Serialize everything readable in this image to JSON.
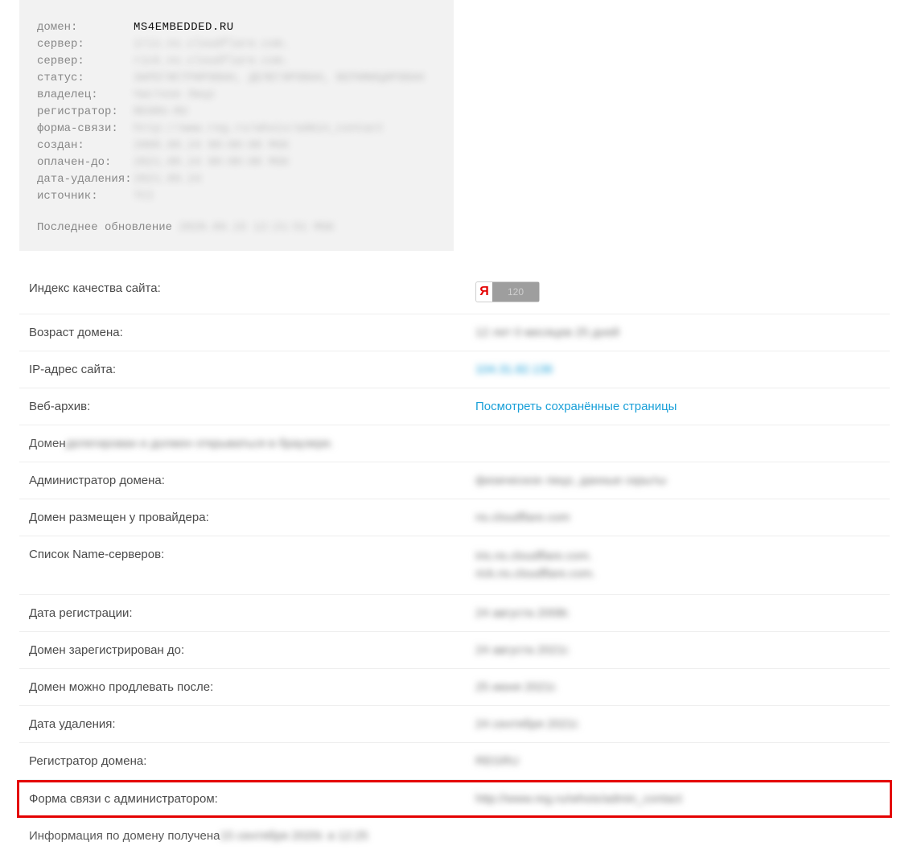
{
  "whois": {
    "fields": [
      {
        "label": "домен:",
        "value": "MS4EMBEDDED.RU",
        "sharp": true
      },
      {
        "label": "сервер:",
        "value": "iris.ns.cloudflare.com.",
        "sharp": false
      },
      {
        "label": "сервер:",
        "value": "rick.ns.cloudflare.com.",
        "sharp": false
      },
      {
        "label": "статус:",
        "value": "ЗАРЕГИСТРИРОВАН, ДЕЛЕГИРОВАН, ВЕРИФИЦИРОВАН",
        "sharp": false
      },
      {
        "label": "владелец:",
        "value": "Частное Лицо",
        "sharp": false
      },
      {
        "label": "регистратор:",
        "value": "REGRU-RU",
        "sharp": false
      },
      {
        "label": "форма-связи:",
        "value": "http://www.reg.ru/whois/admin_contact",
        "sharp": false
      },
      {
        "label": "создан:",
        "value": "2008.08.24 00:00:00 MSK",
        "sharp": false
      },
      {
        "label": "оплачен-до:",
        "value": "2021.08.24 00:00:00 MSK",
        "sharp": false
      },
      {
        "label": "дата-удаления:",
        "value": "2021.09.24",
        "sharp": false
      },
      {
        "label": "источник:",
        "value": "TCI",
        "sharp": false
      }
    ],
    "footer_label": "Последнее обновление",
    "footer_value": "2020.09.15 12:21:51 MSK"
  },
  "badge": {
    "logo": "Я",
    "value": "120"
  },
  "rows": [
    {
      "type": "kv-badge",
      "label": "Индекс качества сайта:"
    },
    {
      "type": "kv",
      "label": "Возраст домена:",
      "value": "12 лет 0 месяцев 25 дней",
      "blur": true
    },
    {
      "type": "kv",
      "label": "IP-адрес сайта:",
      "value": "104.31.82.136",
      "blur": true,
      "link": true
    },
    {
      "type": "kv",
      "label": "Веб-архив:",
      "value": "Посмотреть сохранённые страницы",
      "blur": false,
      "link": true
    },
    {
      "type": "inline",
      "label": "Домен",
      "value": "делегирован и должен открываться в браузере.",
      "blur": true
    },
    {
      "type": "kv",
      "label": "Администратор домена:",
      "value": "физическое лицо, данные скрыты",
      "blur": true
    },
    {
      "type": "kv",
      "label": "Домен размещен у провайдера:",
      "value": "ns.cloudflare.com",
      "blur": true
    },
    {
      "type": "kv-list",
      "label": "Список Name-серверов:",
      "values": [
        "iris.ns.cloudflare.com.",
        "rick.ns.cloudflare.com."
      ],
      "blur": true
    },
    {
      "type": "kv",
      "label": "Дата регистрации:",
      "value": "24 августа 2008г.",
      "blur": true
    },
    {
      "type": "kv",
      "label": "Домен зарегистрирован до:",
      "value": "24 августа 2021г.",
      "blur": true
    },
    {
      "type": "kv",
      "label": "Домен можно продлевать после:",
      "value": "25 июня 2021г.",
      "blur": true
    },
    {
      "type": "kv",
      "label": "Дата удаления:",
      "value": "24 сентября 2021г.",
      "blur": true
    },
    {
      "type": "kv",
      "label": "Регистратор домена:",
      "value": "REGRU",
      "blur": true
    },
    {
      "type": "kv",
      "label": "Форма связи с администратором:",
      "value": "http://www.reg.ru/whois/admin_contact",
      "blur": true,
      "highlight": true
    },
    {
      "type": "inline",
      "label": "Информация по домену получена",
      "value": "15 сентября 2020г. в 12:25",
      "blur": true
    }
  ]
}
